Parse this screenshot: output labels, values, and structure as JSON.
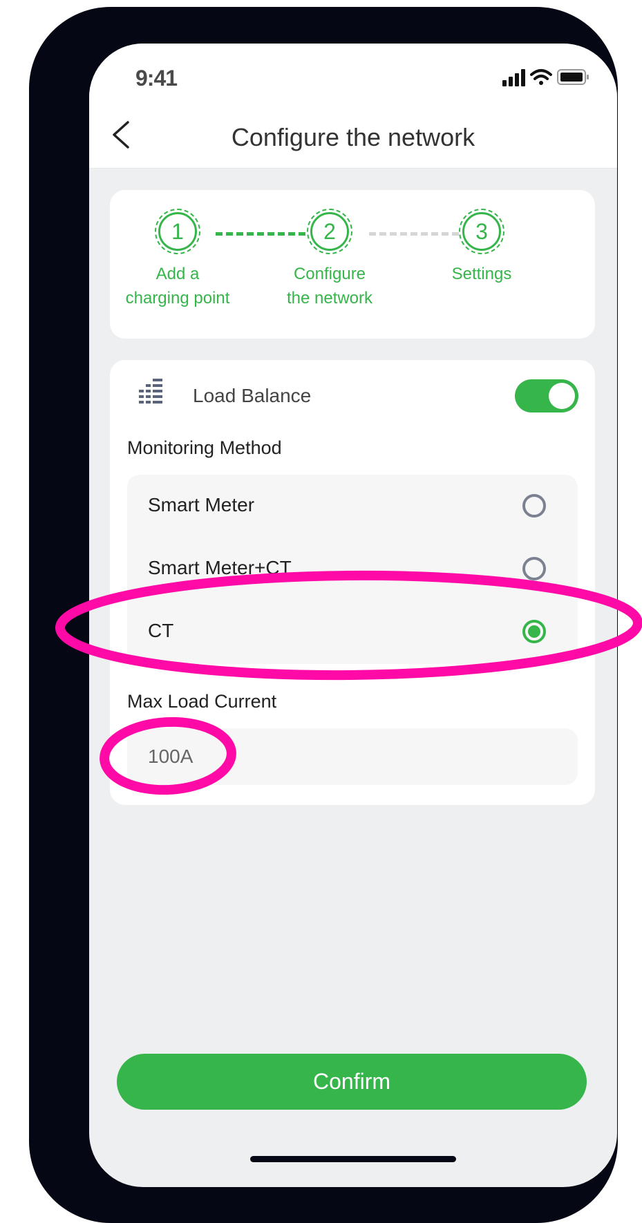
{
  "status_bar": {
    "time": "9:41"
  },
  "header": {
    "title": "Configure the network"
  },
  "steps": [
    {
      "number": "1",
      "label_line1": "Add a",
      "label_line2": "charging point"
    },
    {
      "number": "2",
      "label_line1": "Configure",
      "label_line2": "the network"
    },
    {
      "number": "3",
      "label_line1": "Settings",
      "label_line2": ""
    }
  ],
  "load_balance": {
    "label": "Load Balance",
    "enabled": true
  },
  "monitoring": {
    "label": "Monitoring Method",
    "options": [
      {
        "label": "Smart Meter",
        "selected": false
      },
      {
        "label": "Smart Meter+CT",
        "selected": false
      },
      {
        "label": "CT",
        "selected": true
      }
    ]
  },
  "max_load": {
    "label": "Max Load Current",
    "value": "100A"
  },
  "footer": {
    "confirm_label": "Confirm"
  },
  "colors": {
    "accent": "#36b54a",
    "annotation": "#ff0aa6",
    "frame": "#050814"
  }
}
